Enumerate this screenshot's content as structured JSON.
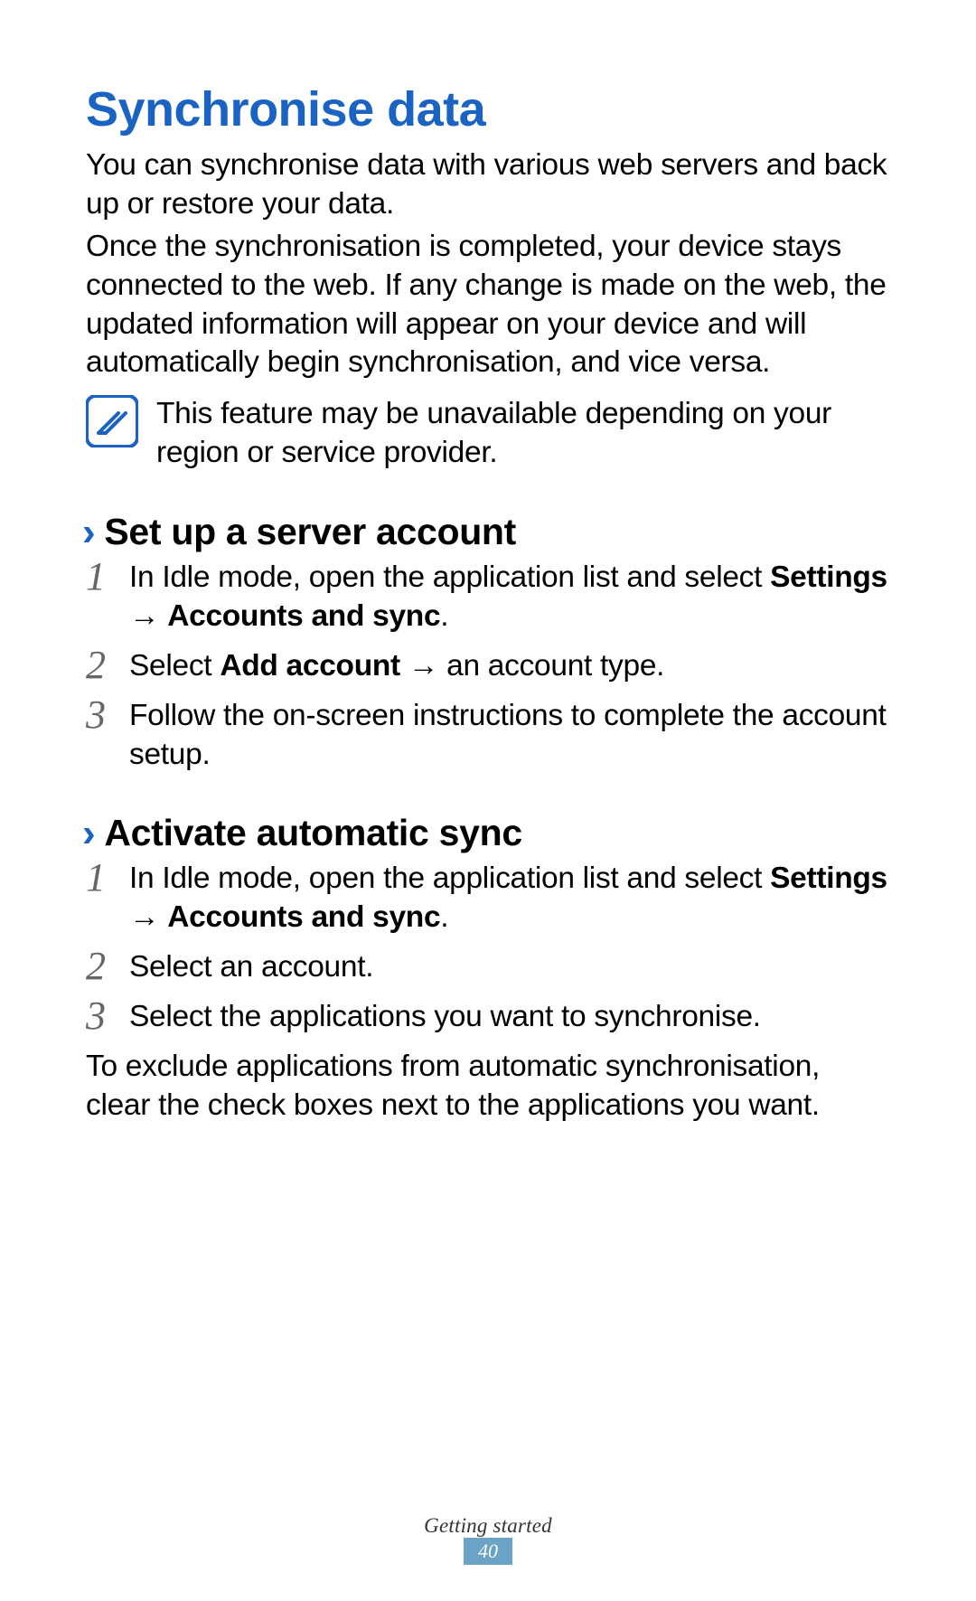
{
  "title": "Synchronise data",
  "intro1": "You can synchronise data with various web servers and back up or restore your data.",
  "intro2": "Once the synchronisation is completed, your device stays connected to the web. If any change is made on the web, the updated information will appear on your device and will automatically begin synchronisation, and vice versa.",
  "note": "This feature may be unavailable depending on your region or service provider.",
  "section1": {
    "heading": "Set up a server account",
    "steps": {
      "s1_a": "In Idle mode, open the application list and select ",
      "s1_b": "Settings",
      "s1_c": "Accounts and sync",
      "s2_a": "Select ",
      "s2_b": "Add account",
      "s2_c": " an account type.",
      "s3": "Follow the on-screen instructions to complete the account setup."
    }
  },
  "section2": {
    "heading": "Activate automatic sync",
    "steps": {
      "s1_a": "In Idle mode, open the application list and select ",
      "s1_b": "Settings",
      "s1_c": "Accounts and sync",
      "s2": "Select an account.",
      "s3": "Select the applications you want to synchronise."
    },
    "trailing": "To exclude applications from automatic synchronisation, clear the check boxes next to the applications you want."
  },
  "arrow": "→",
  "period": ".",
  "footer": {
    "section": "Getting started",
    "page": "40"
  }
}
